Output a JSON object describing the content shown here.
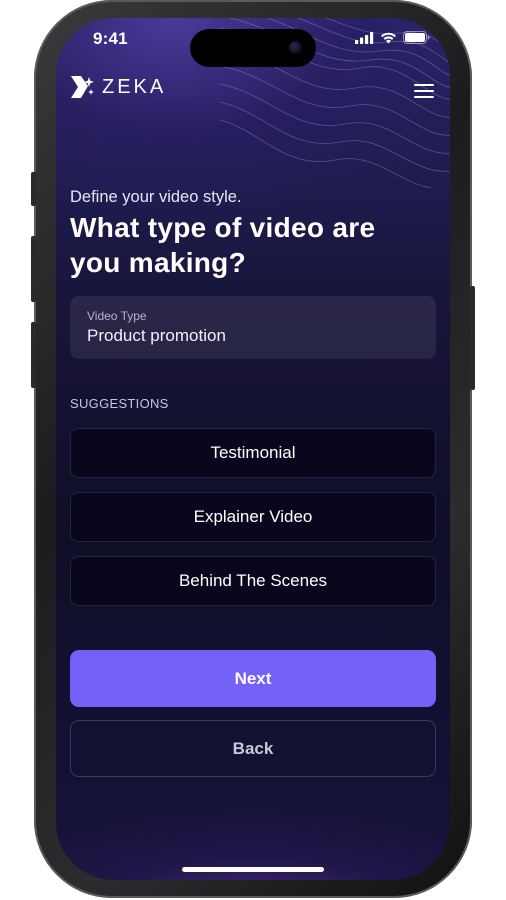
{
  "status_bar": {
    "time": "9:41",
    "icons": [
      "cellular-signal-icon",
      "wifi-icon",
      "battery-icon"
    ]
  },
  "header": {
    "logo_text": "ZEKA",
    "logo_icon": "zeka-logo-icon",
    "menu_icon": "hamburger-menu-icon"
  },
  "step": {
    "subtitle": "Define your video style.",
    "title": "What type of video are you making?"
  },
  "video_type_field": {
    "label": "Video Type",
    "value": "Product promotion"
  },
  "suggestions": {
    "heading": "SUGGESTIONS",
    "items": [
      "Testimonial",
      "Explainer Video",
      "Behind The Scenes"
    ]
  },
  "actions": {
    "next_label": "Next",
    "back_label": "Back"
  },
  "colors": {
    "accent": "#7461f7",
    "background_top": "#2a2468",
    "background_mid": "#0f0e28",
    "suggestion_bg": "#08071d"
  }
}
